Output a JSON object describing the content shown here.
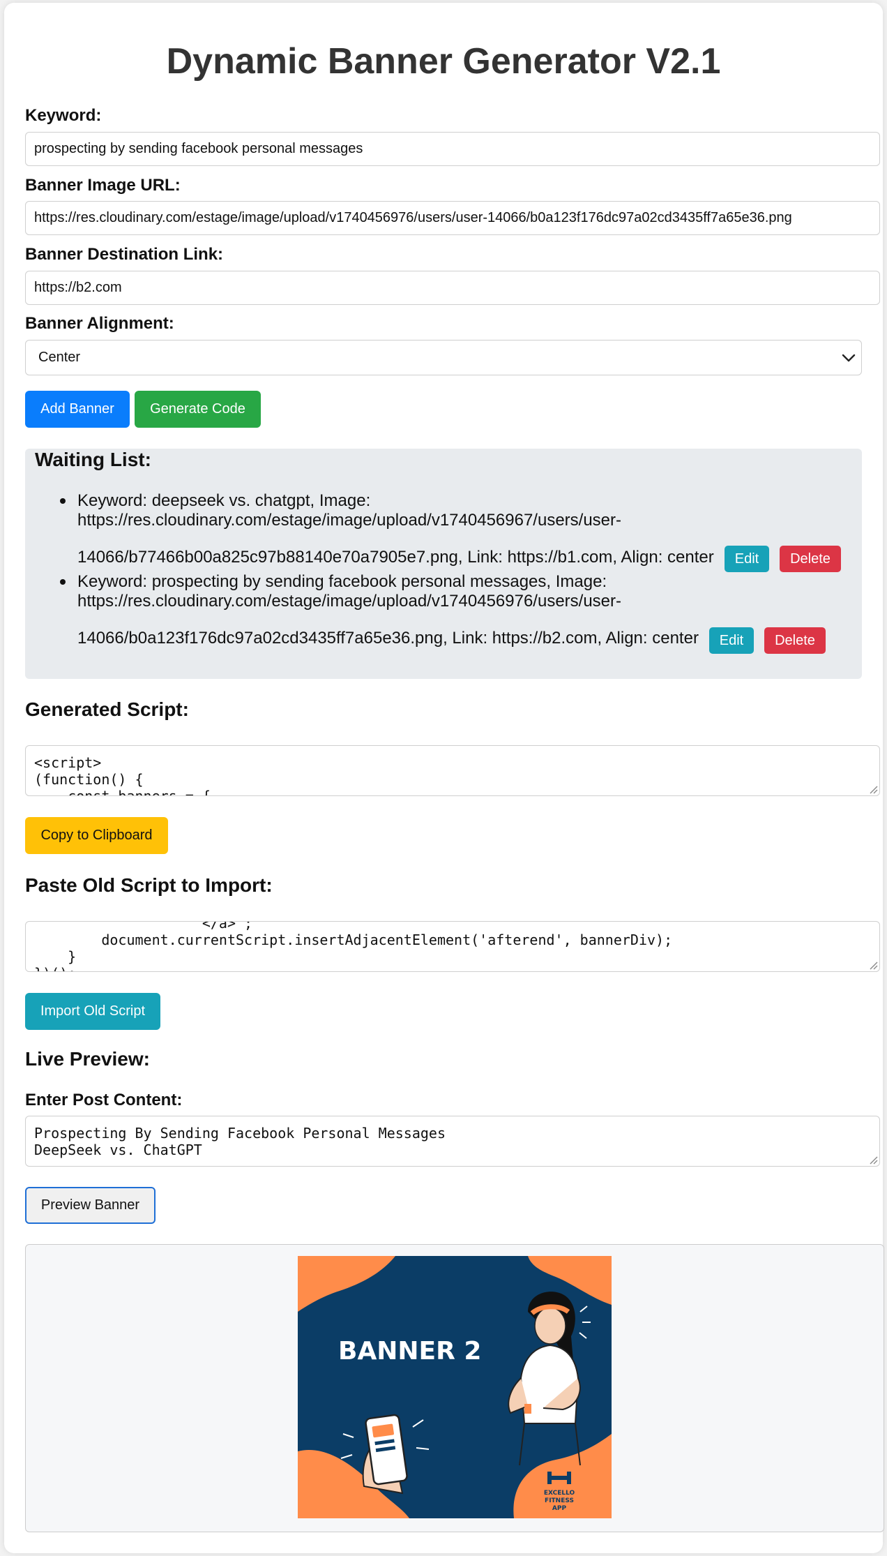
{
  "title": "Dynamic Banner Generator V2.1",
  "form": {
    "keyword_label": "Keyword:",
    "keyword_value": "prospecting by sending facebook personal messages",
    "image_url_label": "Banner Image URL:",
    "image_url_value": "https://res.cloudinary.com/estage/image/upload/v1740456976/users/user-14066/b0a123f176dc97a02cd3435ff7a65e36.png",
    "dest_label": "Banner Destination Link:",
    "dest_value": "https://b2.com",
    "align_label": "Banner Alignment:",
    "align_value": "Center"
  },
  "buttons": {
    "add_banner": "Add Banner",
    "generate_code": "Generate Code",
    "copy": "Copy to Clipboard",
    "import": "Import Old Script",
    "preview": "Preview Banner"
  },
  "waiting": {
    "heading": "Waiting List:",
    "items": [
      {
        "line1": "Keyword: deepseek vs. chatgpt, Image:",
        "line2": "https://res.cloudinary.com/estage/image/upload/v1740456967/users/user-",
        "line3": "14066/b77466b00a825c97b88140e70a7905e7.png, Link: https://b1.com, Align: center",
        "edit": "Edit",
        "delete": "Delete"
      },
      {
        "line1": "Keyword: prospecting by sending facebook personal messages, Image:",
        "line2": "https://res.cloudinary.com/estage/image/upload/v1740456976/users/user-",
        "line3": "14066/b0a123f176dc97a02cd3435ff7a65e36.png, Link: https://b2.com, Align: center",
        "edit": "Edit",
        "delete": "Delete"
      }
    ]
  },
  "generated": {
    "heading": "Generated Script:",
    "code": "<script>\n(function() {\n    const banners = {"
  },
  "import_section": {
    "heading": "Paste Old Script to Import:",
    "code": "                    </a>`;\n        document.currentScript.insertAdjacentElement('afterend', bannerDiv);\n    }\n})();"
  },
  "live": {
    "heading": "Live Preview:",
    "post_label": "Enter Post Content:",
    "post_content": "Prospecting By Sending Facebook Personal Messages\nDeepSeek vs. ChatGPT"
  },
  "banner": {
    "headline": "BANNER 2",
    "brand": [
      "EXCELLO",
      "FITNESS",
      "APP"
    ],
    "colors": {
      "navy": "#0b3d66",
      "orange": "#ff8c4a"
    }
  },
  "colors": {
    "primary": "#0a7dfc",
    "success": "#28a745",
    "warning": "#ffc107",
    "info": "#17a2b8",
    "danger": "#dc3545"
  }
}
